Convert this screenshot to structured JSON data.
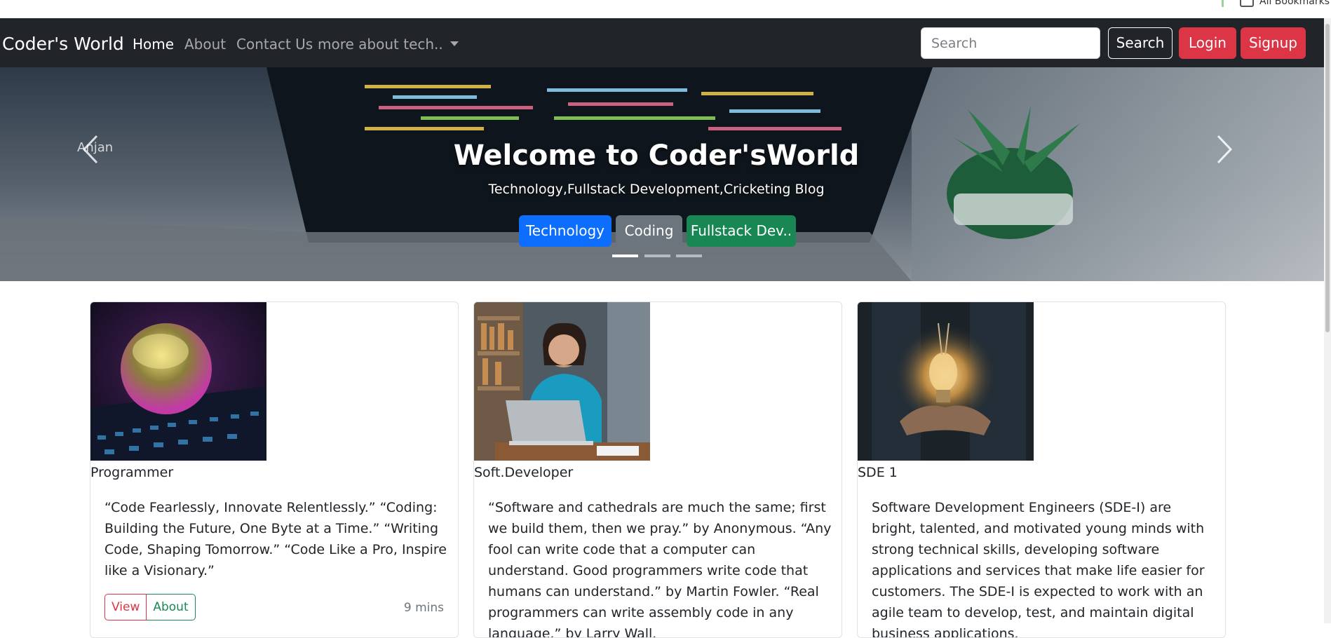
{
  "browser": {
    "bookmarks_label": "All Bookmarks"
  },
  "navbar": {
    "brand": "Coder's World",
    "links": [
      "Home",
      "About",
      "Contact Us"
    ],
    "dropdown_label": "more about tech..",
    "search_placeholder": "Search",
    "search_button": "Search",
    "login_button": "Login",
    "signup_button": "Signup"
  },
  "hero": {
    "side_label": "Anjan",
    "title": "Welcome to Coder'sWorld",
    "subtitle": "Technology,Fullstack Development,Cricketing Blog",
    "buttons": [
      "Technology",
      "Coding",
      "Fullstack Dev.."
    ],
    "active_slide": 1,
    "slide_count": 3
  },
  "cards": [
    {
      "label": "Programmer",
      "text": "“Code Fearlessly, Innovate Relentlessly.” “Coding: Building the Future, One Byte at a Time.” “Writing Code, Shaping Tomorrow.” “Code Like a Pro, Inspire like a Visionary.”",
      "view_button": "View",
      "about_button": "About",
      "read_time": "9 mins"
    },
    {
      "label": "Soft.Developer",
      "text": "“Software and cathedrals are much the same; first we build them, then we pray.” by Anonymous. “Any fool can write code that a computer can understand. Good programmers write code that humans can understand.” by Martin Fowler. “Real programmers can write assembly code in any language.” by Larry Wall."
    },
    {
      "label": "SDE 1",
      "text": "Software Development Engineers (SDE-I) are bright, talented, and motivated young minds with strong technical skills, developing software applications and services that make life easier for customers. The SDE-I is expected to work with an agile team to develop, test, and maintain digital business applications."
    }
  ],
  "colors": {
    "navbar_bg": "#212529",
    "danger": "#dc3545",
    "primary": "#0d6efd",
    "secondary": "#6c757d",
    "success": "#198754"
  }
}
